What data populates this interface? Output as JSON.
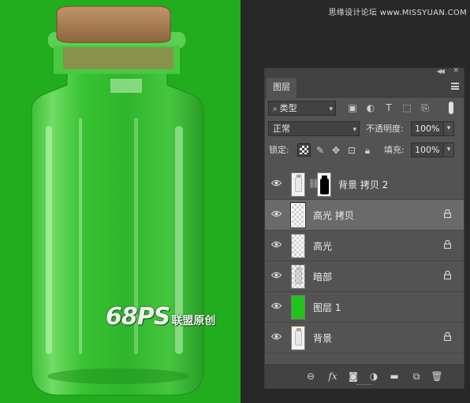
{
  "site_banner": "思缘设计论坛 www.MISSYUAN.COM",
  "watermark": {
    "logo": "68PS",
    "text": "联盟原创"
  },
  "panel": {
    "tab": "图层",
    "filter": {
      "label": "类型"
    },
    "blend_mode": "正常",
    "opacity_label": "不透明度:",
    "opacity_value": "100%",
    "lock_label": "锁定:",
    "fill_label": "填充:",
    "fill_value": "100%"
  },
  "layers": [
    {
      "name": "背景 拷贝 2",
      "thumb": "bottle",
      "has_mask": true,
      "locked": false,
      "selected": false,
      "visible": true
    },
    {
      "name": "高光 拷贝",
      "thumb": "checker",
      "has_mask": false,
      "locked": true,
      "selected": true,
      "visible": true
    },
    {
      "name": "高光",
      "thumb": "checker",
      "has_mask": false,
      "locked": true,
      "selected": false,
      "visible": true
    },
    {
      "name": "暗部",
      "thumb": "dark-bottle",
      "has_mask": false,
      "locked": true,
      "selected": false,
      "visible": true
    },
    {
      "name": "图层 1",
      "thumb": "green",
      "has_mask": false,
      "locked": false,
      "selected": false,
      "visible": true
    },
    {
      "name": "背景",
      "thumb": "bottle",
      "has_mask": false,
      "locked": true,
      "selected": false,
      "visible": true
    }
  ],
  "bottom_icons": [
    "link-icon",
    "fx-icon",
    "mask-icon",
    "adjustment-icon",
    "folder-icon",
    "new-layer-icon",
    "trash-icon"
  ],
  "colors": {
    "canvas_green": "#22ad1f",
    "panel_bg": "#535353",
    "workspace_bg": "#282828"
  }
}
